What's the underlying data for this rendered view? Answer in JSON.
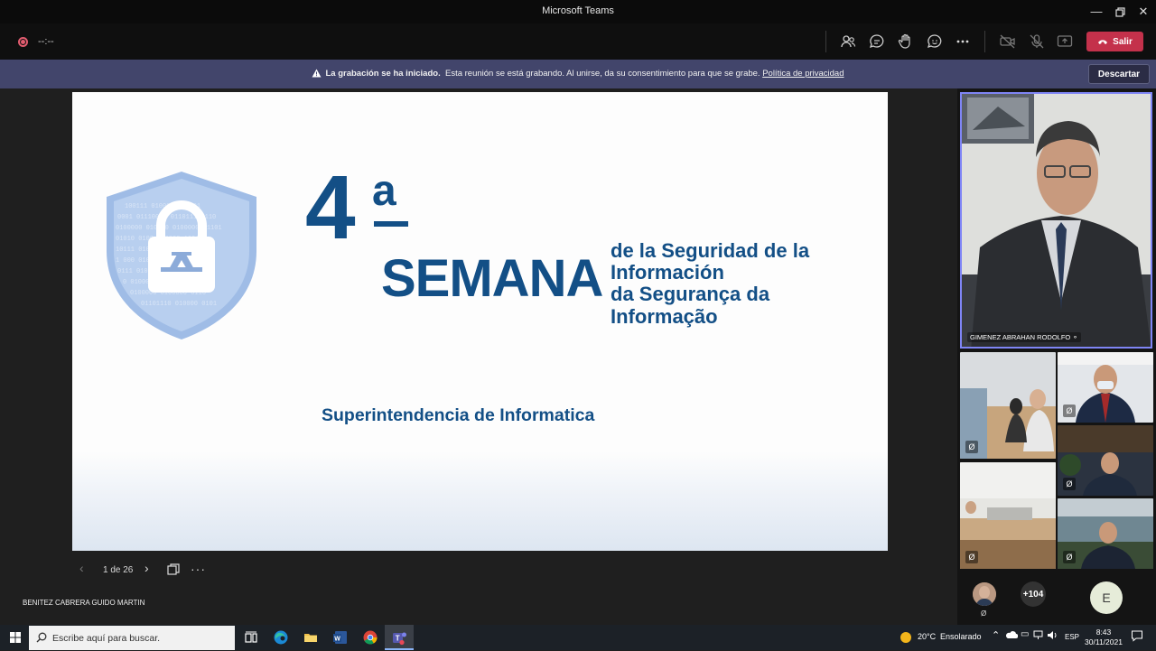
{
  "window": {
    "title": "Microsoft Teams",
    "controls": [
      "minimize",
      "restore",
      "close"
    ]
  },
  "toolbar": {
    "timer": "--:--",
    "icons": [
      "people-icon",
      "chat-icon",
      "raise-hand-icon",
      "reactions-icon",
      "more-options-icon",
      "camera-off-icon",
      "mic-off-icon",
      "share-icon"
    ],
    "leave_label": "Salir"
  },
  "recording_banner": {
    "bold": "La grabación se ha iniciado.",
    "text": "Esta reunión se está grabando. Al unirse, da su consentimiento para que se grabe.",
    "link": "Política de privacidad",
    "dismiss_label": "Descartar"
  },
  "slide": {
    "number": "4",
    "ordinal": "a",
    "semana": "SEMANA",
    "subtitle_lines": [
      "de la Seguridad de la",
      "Información",
      "da Segurança da",
      "Informação"
    ],
    "department": "Superintendencia de Informatica",
    "brand_color": "#134f86"
  },
  "slide_nav": {
    "counter": "1 de 26"
  },
  "presenter": {
    "name": "BENITEZ CABRERA GUIDO MARTIN"
  },
  "main_participant": {
    "name": "GIMENEZ ABRAHAN RODOLFO"
  },
  "participants": {
    "overflow_count": "+104",
    "initial_avatar": "E"
  },
  "taskbar": {
    "search_placeholder": "Escribe aquí para buscar.",
    "weather_temp": "20°C",
    "weather_text": "Ensolarado",
    "language": "ESP",
    "time": "8:43",
    "date": "30/11/2021"
  }
}
